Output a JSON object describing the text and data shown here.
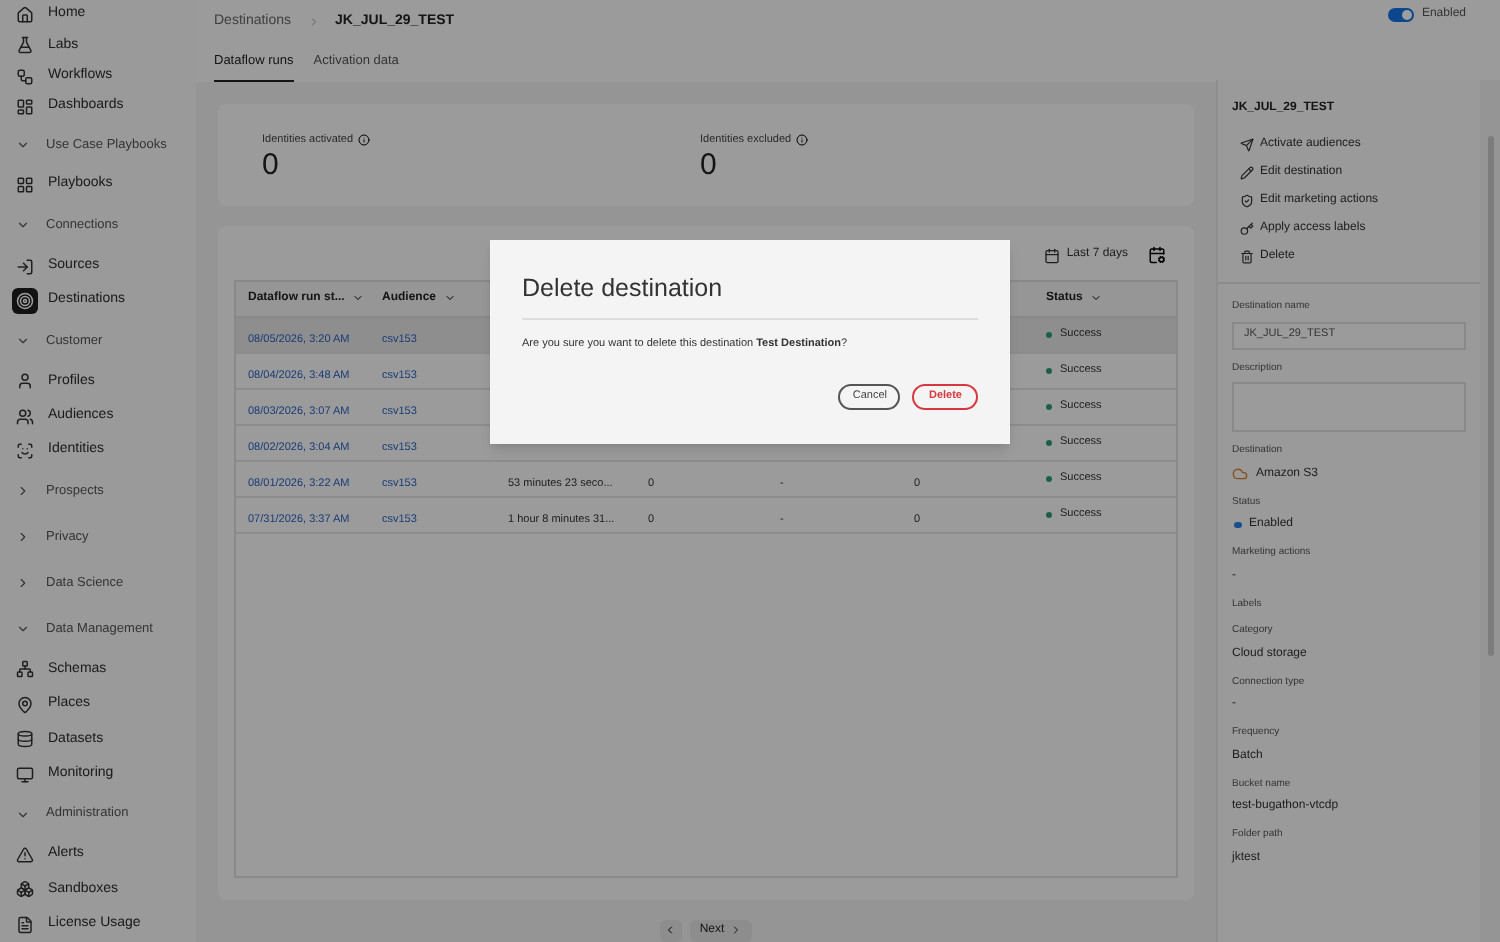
{
  "sidebar": {
    "items": [
      {
        "kind": "link",
        "label": "Home",
        "selected": false
      },
      {
        "kind": "link",
        "label": "Labs",
        "selected": false
      },
      {
        "kind": "link",
        "label": "Workflows",
        "selected": false
      },
      {
        "kind": "link",
        "label": "Dashboards",
        "selected": false
      },
      {
        "kind": "section",
        "label": "Use Case Playbooks",
        "expanded": true,
        "children": [
          {
            "kind": "link",
            "label": "Playbooks",
            "selected": false
          }
        ]
      },
      {
        "kind": "section",
        "label": "Connections",
        "expanded": true,
        "children": [
          {
            "kind": "link",
            "label": "Sources",
            "selected": false
          },
          {
            "kind": "link",
            "label": "Destinations",
            "selected": true
          }
        ]
      },
      {
        "kind": "section",
        "label": "Customer",
        "expanded": true,
        "children": [
          {
            "kind": "link",
            "label": "Profiles",
            "selected": false
          },
          {
            "kind": "link",
            "label": "Audiences",
            "selected": false
          },
          {
            "kind": "link",
            "label": "Identities",
            "selected": false
          }
        ]
      },
      {
        "kind": "section",
        "label": "Prospects",
        "expanded": false
      },
      {
        "kind": "section",
        "label": "Privacy",
        "expanded": false
      },
      {
        "kind": "section",
        "label": "Data Science",
        "expanded": false
      },
      {
        "kind": "section",
        "label": "Data Management",
        "expanded": true,
        "children": [
          {
            "kind": "link",
            "label": "Schemas",
            "selected": false
          },
          {
            "kind": "link",
            "label": "Places",
            "selected": false
          },
          {
            "kind": "link",
            "label": "Datasets",
            "selected": false
          },
          {
            "kind": "link",
            "label": "Monitoring",
            "selected": false
          }
        ]
      },
      {
        "kind": "section",
        "label": "Administration",
        "expanded": true,
        "children": [
          {
            "kind": "link",
            "label": "Alerts",
            "selected": false
          },
          {
            "kind": "link",
            "label": "Sandboxes",
            "selected": false
          },
          {
            "kind": "link",
            "label": "License Usage",
            "selected": false
          }
        ]
      }
    ]
  },
  "breadcrumb": [
    "Destinations",
    "JK_JUL_29_TEST"
  ],
  "enabled_toggle": {
    "label": "Enabled",
    "on": true
  },
  "tabs": [
    {
      "label": "Dataflow runs",
      "selected": true
    },
    {
      "label": "Activation data",
      "selected": false
    }
  ],
  "metrics": [
    {
      "label": "Identities activated",
      "value": "0"
    },
    {
      "label": "Identities excluded",
      "value": "0"
    }
  ],
  "date_filter": "Last 7 days",
  "table": {
    "columns": [
      "Dataflow run st...",
      "Audience",
      null,
      null,
      null,
      null,
      "Status"
    ],
    "rows": [
      {
        "selected": true,
        "start": "08/05/2026, 3:20 AM",
        "audience": "csv153",
        "status": "Success"
      },
      {
        "selected": false,
        "start": "08/04/2026, 3:48 AM",
        "audience": "csv153",
        "status": "Success"
      },
      {
        "selected": false,
        "start": "08/03/2026, 3:07 AM",
        "audience": "csv153",
        "status": "Success"
      },
      {
        "selected": false,
        "start": "08/02/2026, 3:04 AM",
        "audience": "csv153",
        "status": "Success"
      },
      {
        "selected": false,
        "start": "08/01/2026, 3:22 AM",
        "audience": "csv153",
        "column_3": "53 minutes 23 seco...",
        "column_4": "0",
        "column_5": "-",
        "column_6": "0",
        "status": "Success"
      },
      {
        "selected": false,
        "start": "07/31/2026, 3:37 AM",
        "audience": "csv153",
        "column_3": "1 hour 8 minutes 31...",
        "column_4": "0",
        "column_5": "-",
        "column_6": "0",
        "status": "Success"
      }
    ]
  },
  "pagination": {
    "next": "Next"
  },
  "panel": {
    "title": "JK_JUL_29_TEST",
    "actions": [
      "Activate audiences",
      "Edit destination",
      "Edit marketing actions",
      "Apply access labels",
      "Delete"
    ],
    "fields": [
      {
        "kind": "input",
        "label": "Destination name",
        "value": "JK_JUL_29_TEST"
      },
      {
        "kind": "textarea",
        "label": "Description"
      },
      {
        "kind": "destination",
        "label": "Destination",
        "value": "Amazon S3"
      },
      {
        "kind": "status",
        "label": "Status",
        "value": "Enabled"
      },
      {
        "kind": "text",
        "label": "Marketing actions",
        "value": "-"
      },
      {
        "kind": "text",
        "label": "Labels"
      },
      {
        "kind": "text",
        "label": "Category",
        "value": "Cloud storage"
      },
      {
        "kind": "text",
        "label": "Connection type",
        "value": "-"
      },
      {
        "kind": "text",
        "label": "Frequency",
        "value": "Batch"
      },
      {
        "kind": "text",
        "label": "Bucket name",
        "value": "test-bugathon-vtcdp"
      },
      {
        "kind": "text",
        "label": "Folder path",
        "value": "jktest"
      }
    ]
  },
  "dialog": {
    "title": "Delete destination",
    "message": "Are you sure you want to delete this destination **Test Destination**?",
    "buttons": [
      {
        "kind": "secondary",
        "label": "Cancel"
      },
      {
        "kind": "negative",
        "label": "Delete"
      }
    ]
  }
}
